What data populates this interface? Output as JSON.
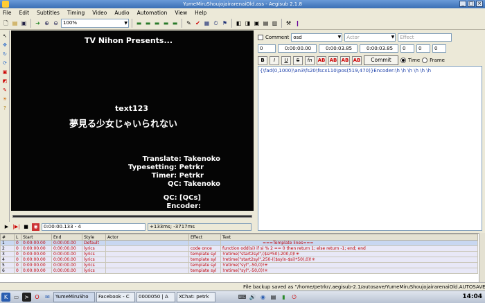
{
  "window": {
    "title": "YumeMiruShoujojairarenaiOld.ass - Aegisub 2.1.8"
  },
  "menu": [
    "File",
    "Edit",
    "Subtitles",
    "Timing",
    "Video",
    "Audio",
    "Automation",
    "View",
    "Help"
  ],
  "toolbar": {
    "zoom": "100%"
  },
  "video": {
    "presents": "TV Nihon Presents...",
    "text123": "text123",
    "japanese": "夢見る少女じゃいられない",
    "credits": [
      "Translate: Takenoko",
      "Typesetting: Petrkr",
      "Timer: Petrkr",
      "QC: Takenoko",
      "QC: [QCs]",
      "Encoder:"
    ]
  },
  "playback": {
    "time": "0:00:00.133 - 4",
    "offset": "+133ms; -3717ms"
  },
  "editor": {
    "comment_label": "Comment",
    "style": "osd",
    "actor_placeholder": "Actor",
    "effect_placeholder": "Effect",
    "layer": "0",
    "start": "0:00:00.00",
    "end": "0:00:03.85",
    "duration": "0:00:03.85",
    "margin_l": "0",
    "margin_r": "0",
    "margin_v": "0",
    "commit_label": "Commit",
    "time_label": "Time",
    "frame_label": "Frame",
    "text": "{\\fad(0,1000)\\an3\\fs20\\fscx110\\pos(519,470)}Encoder:\\h \\h \\h \\h \\h \\h"
  },
  "grid": {
    "headers": [
      "#",
      "L",
      "Start",
      "End",
      "Style",
      "Actor",
      "Effect",
      "Text"
    ],
    "rows": [
      [
        "1",
        "0",
        "0:00:00.00",
        "0:00:00.00",
        "Default",
        "",
        "",
        "===Template lines==="
      ],
      [
        "2",
        "0",
        "0:00:00.00",
        "0:00:00.00",
        "lyrics",
        "",
        "code once",
        "function odd(si) if si % 2 == 0 then return 1; else return -1; end; end"
      ],
      [
        "3",
        "0",
        "0:00:00.00",
        "0:00:00.00",
        "lyrics",
        "",
        "template syl",
        "!retime(\"start2syl\",($si*50)-200,0)!✳"
      ],
      [
        "4",
        "0",
        "0:00:00.00",
        "0:00:00.00",
        "lyrics",
        "",
        "template syl",
        "!retime(\"start2syl\",250-(($syln-$si)*50),0)!✳"
      ],
      [
        "5",
        "0",
        "0:00:00.00",
        "0:00:00.00",
        "lyrics",
        "",
        "template syl",
        "!retime(\"syl\",-50,0)!✳"
      ],
      [
        "6",
        "0",
        "0:00:00.00",
        "0:00:00.00",
        "lyrics",
        "",
        "template syl",
        "!retime(\"syl\",-50,0)!✳"
      ]
    ]
  },
  "status": {
    "message": "File backup saved as \"/home/petrkr/.aegisub-2.1/autosave/YumeMiruShoujojairarenaiOld.AUTOSAVE.ass\"."
  },
  "taskbar": {
    "tasks": [
      "YumeMiruSho",
      "Facebook - C",
      "0000050 | A",
      "XChat: petrk"
    ],
    "clock": "14:04"
  }
}
